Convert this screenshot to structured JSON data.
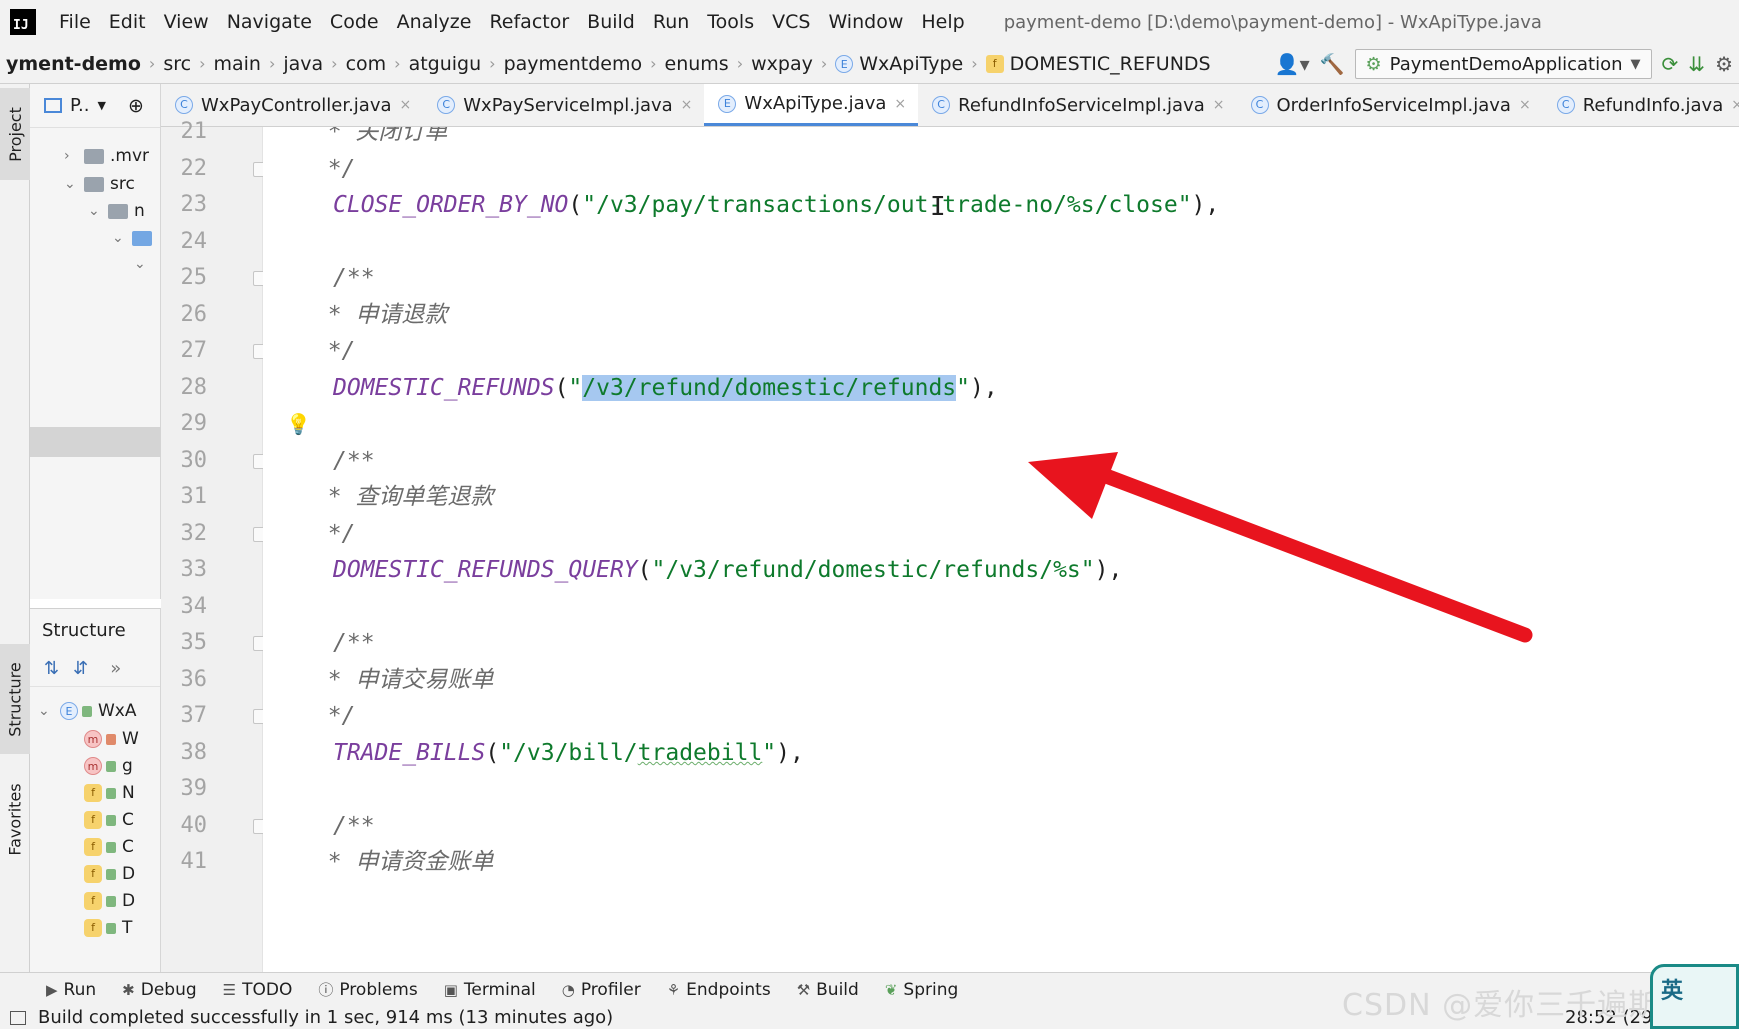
{
  "app_logo": "IJ",
  "menu": [
    "File",
    "Edit",
    "View",
    "Navigate",
    "Code",
    "Analyze",
    "Refactor",
    "Build",
    "Run",
    "Tools",
    "VCS",
    "Window",
    "Help"
  ],
  "window_title": "payment-demo [D:\\demo\\payment-demo] - WxApiType.java",
  "breadcrumbs": [
    "yment-demo",
    "src",
    "main",
    "java",
    "com",
    "atguigu",
    "paymentdemo",
    "enums",
    "wxpay",
    "WxApiType",
    "DOMESTIC_REFUNDS"
  ],
  "run_config": "PaymentDemoApplication",
  "project_panel": {
    "title": "P..",
    "tree": [
      ".mvr",
      "src",
      "n",
      ""
    ]
  },
  "structure_panel": {
    "title": "Structure",
    "root": "WxA",
    "members": [
      {
        "kind": "m",
        "label": "W"
      },
      {
        "kind": "m",
        "label": "g"
      },
      {
        "kind": "f",
        "label": "N"
      },
      {
        "kind": "f",
        "label": "C"
      },
      {
        "kind": "f",
        "label": "C"
      },
      {
        "kind": "f",
        "label": "D"
      },
      {
        "kind": "f",
        "label": "D"
      },
      {
        "kind": "f",
        "label": "T"
      }
    ]
  },
  "side_tabs": {
    "project": "Project",
    "structure": "Structure",
    "favorites": "Favorites"
  },
  "editor_tabs": [
    {
      "label": "WxPayController.java",
      "active": false
    },
    {
      "label": "WxPayServiceImpl.java",
      "active": false
    },
    {
      "label": "WxApiType.java",
      "active": true
    },
    {
      "label": "RefundInfoServiceImpl.java",
      "active": false
    },
    {
      "label": "OrderInfoServiceImpl.java",
      "active": false
    },
    {
      "label": "RefundInfo.java",
      "active": false
    }
  ],
  "code": {
    "line_numbers": [
      "21",
      "22",
      "23",
      "24",
      "25",
      "26",
      "27",
      "28",
      "29",
      "30",
      "31",
      "32",
      "33",
      "34",
      "35",
      "36",
      "37",
      "38",
      "39",
      "40",
      "41"
    ],
    "l21": "  * 关闭订单",
    "l22": "  */",
    "l23_name": "CLOSE_ORDER_BY_NO",
    "l23_str": "\"/v3/pay/transactions/out-trade-no/%s/close\"",
    "l25": "/**",
    "l26": "  * 申请退款",
    "l27": "  */",
    "l28_name": "DOMESTIC_REFUNDS",
    "l28_selected": "/v3/refund/domestic/refunds",
    "l30": "/**",
    "l31": "  * 查询单笔退款",
    "l32": "  */",
    "l33_name": "DOMESTIC_REFUNDS_QUERY",
    "l33_str": "\"/v3/refund/domestic/refunds/%s\"",
    "l35": "/**",
    "l36": "  * 申请交易账单",
    "l37": "  */",
    "l38_name": "TRADE_BILLS",
    "l38_str_a": "\"/v3/bill/",
    "l38_str_b": "tradebill",
    "l38_str_c": "\"",
    "l40": "/**",
    "l41": "  * 申请资金账单"
  },
  "toolbar": [
    "Run",
    "Debug",
    "TODO",
    "Problems",
    "Terminal",
    "Profiler",
    "Endpoints",
    "Build",
    "Spring"
  ],
  "status": {
    "message": "Build completed successfully in 1 sec, 914 ms (13 minutes ago)",
    "caret": "28:52 (29"
  },
  "watermark": "CSDN @爱你三千遍斯塔克",
  "corner_badge": "英",
  "colors": {
    "accent": "#4a88d8",
    "arrow": "#e8141e",
    "selection": "#a6c8f0",
    "string": "#0e7a2c",
    "constant": "#7a3e9d"
  }
}
